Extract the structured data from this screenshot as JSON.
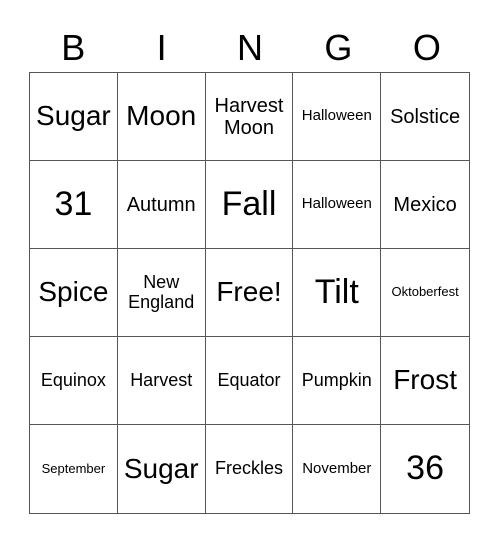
{
  "header": [
    "B",
    "I",
    "N",
    "G",
    "O"
  ],
  "cells": [
    {
      "text": "Sugar",
      "size": "l"
    },
    {
      "text": "Moon",
      "size": "l"
    },
    {
      "text": "Harvest Moon",
      "size": "m"
    },
    {
      "text": "Halloween",
      "size": "xs"
    },
    {
      "text": "Solstice",
      "size": "m"
    },
    {
      "text": "31",
      "size": "xl"
    },
    {
      "text": "Autumn",
      "size": "m"
    },
    {
      "text": "Fall",
      "size": "xl"
    },
    {
      "text": "Halloween",
      "size": "xs"
    },
    {
      "text": "Mexico",
      "size": "m"
    },
    {
      "text": "Spice",
      "size": "l"
    },
    {
      "text": "New England",
      "size": "s"
    },
    {
      "text": "Free!",
      "size": "l"
    },
    {
      "text": "Tilt",
      "size": "xl"
    },
    {
      "text": "Oktoberfest",
      "size": "xxs"
    },
    {
      "text": "Equinox",
      "size": "s"
    },
    {
      "text": "Harvest",
      "size": "s"
    },
    {
      "text": "Equator",
      "size": "s"
    },
    {
      "text": "Pumpkin",
      "size": "s"
    },
    {
      "text": "Frost",
      "size": "l"
    },
    {
      "text": "September",
      "size": "xxs"
    },
    {
      "text": "Sugar",
      "size": "l"
    },
    {
      "text": "Freckles",
      "size": "s"
    },
    {
      "text": "November",
      "size": "xs"
    },
    {
      "text": "36",
      "size": "xl"
    }
  ]
}
